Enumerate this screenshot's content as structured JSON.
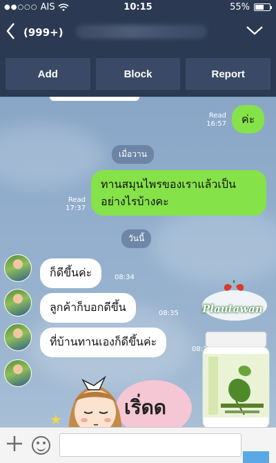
{
  "status_bar": {
    "carrier": "AIS",
    "time": "10:15",
    "battery": "55%",
    "battery_level": 0.55
  },
  "header": {
    "back_icon": "chevron-left-icon",
    "unread_count": "(999+)",
    "menu_icon": "chevron-down-icon"
  },
  "actions": {
    "add_label": "Add",
    "block_label": "Block",
    "report_label": "Report"
  },
  "messages": {
    "m1": {
      "text": "ค่ะ",
      "read_label": "Read",
      "time": "16:57"
    },
    "date1": "เมื่อวาน",
    "m2": {
      "text": "ทานสมุนไพรของเราแล้วเป็นอย่างไรบ้างคะ",
      "read_label": "Read",
      "time": "17:37"
    },
    "date2": "วันนี้",
    "r1": {
      "text": "ก็ดีขึ้นค่ะ",
      "time": "08:34"
    },
    "r2": {
      "text": "ลูกค้าก็บอกดีขึ้น",
      "time": "08:35"
    },
    "r3": {
      "text": "ที่บ้านทานเองก็ดีขึ้นค่ะ",
      "time": "08:35"
    },
    "sticker_text": "เริ่ดด"
  },
  "overlay": {
    "brand": "Plautawan"
  },
  "input_bar": {
    "placeholder": ""
  },
  "colors": {
    "header_bg": "#2b3a52",
    "outgoing_bubble": "#85e249",
    "incoming_bubble": "#ffffff",
    "brand_green": "#2b6d26"
  }
}
